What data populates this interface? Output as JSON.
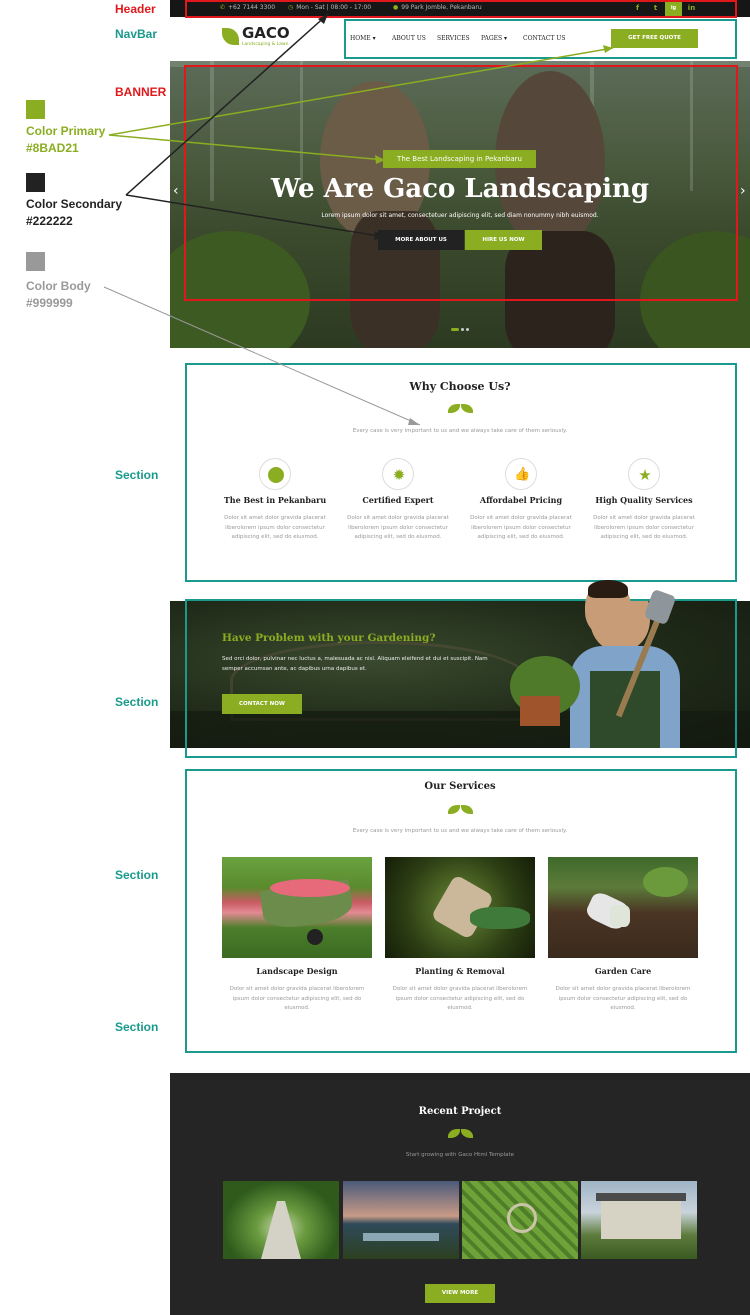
{
  "annotations": {
    "header": "Header",
    "navbar": "NavBar",
    "banner": "BANNER",
    "section_labels": [
      "Section",
      "Section",
      "Section",
      "Section"
    ],
    "colors": [
      {
        "name": "Color Primary",
        "hex": "#8BAD21",
        "swatch": "#8BAD21",
        "text_color": "#8BAD21"
      },
      {
        "name": "Color Secondary",
        "hex": "#222222",
        "swatch": "#222222",
        "text_color": "#222222"
      },
      {
        "name": "Color Body",
        "hex": "#999999",
        "swatch": "#999999",
        "text_color": "#999999"
      }
    ]
  },
  "topbar": {
    "phone": "+62 7144 3300",
    "hours": "Mon - Sat | 08:00 - 17:00",
    "address": "99 Park Jomble, Pekanbaru",
    "social": [
      "f",
      "t",
      "ig",
      "in"
    ]
  },
  "navbar": {
    "logo_title": "GACO",
    "logo_sub": "Landscaping & Lawn",
    "items": [
      "HOME",
      "ABOUT US",
      "SERVICES",
      "PAGES",
      "CONTACT US"
    ],
    "cta": "GET FREE QUOTE"
  },
  "banner": {
    "tag": "The Best Landscaping in Pekanbaru",
    "title": "We Are Gaco Landscaping",
    "desc": "Lorem ipsum dolor sit amet, consectetuer adipiscing elit, sed diam nonummy nibh euismod.",
    "btn_more": "MORE ABOUT US",
    "btn_hire": "HIRE US NOW",
    "prev": "‹",
    "next": "›"
  },
  "why": {
    "title": "Why Choose Us?",
    "sub": "Every case is very important to us and we always take care of them seriously.",
    "items": [
      {
        "title": "The Best in Pekanbaru",
        "icon": "globe-icon",
        "text": "Dolor sit amet dolor gravida placerat liberolorem ipsum dolor consectetur adipiscing elit, sed do eiusmod."
      },
      {
        "title": "Certified Expert",
        "icon": "badge-icon",
        "text": "Dolor sit amet dolor gravida placerat liberolorem ipsum dolor consectetur adipiscing elit, sed do eiusmod."
      },
      {
        "title": "Affordabel Pricing",
        "icon": "thumbs-up-icon",
        "text": "Dolor sit amet dolor gravida placerat liberolorem ipsum dolor consectetur adipiscing elit, sed do eiusmod."
      },
      {
        "title": "High Quality Services",
        "icon": "star-icon",
        "text": "Dolor sit amet dolor gravida placerat liberolorem ipsum dolor consectetur adipiscing elit, sed do eiusmod."
      }
    ]
  },
  "cta": {
    "title": "Have Problem with your Gardening?",
    "text": "Sed orci dolor, pulvinar nec luctus a, malesuada ac nisl. Aliquam eleifend et dui et suscipit. Nam semper accumsan ante, ac dapibus urna dapibus et.",
    "button": "CONTACT NOW"
  },
  "services": {
    "title": "Our Services",
    "sub": "Every case is very important to us and we always take care of them seriously.",
    "items": [
      {
        "title": "Landscape Design",
        "text": "Dolor sit amet dolor gravida placerat liberolorem ipsum dolor consectetur adipiscing elit, sed do eiusmod."
      },
      {
        "title": "Planting & Removal",
        "text": "Dolor sit amet dolor gravida placerat liberolorem ipsum dolor consectetur adipiscing elit, sed do eiusmod."
      },
      {
        "title": "Garden Care",
        "text": "Dolor sit amet dolor gravida placerat liberolorem ipsum dolor consectetur adipiscing elit, sed do eiusmod."
      }
    ]
  },
  "recent": {
    "title": "Recent Project",
    "sub": "Start growing with Gaco Html Template",
    "button": "VIEW MORE"
  }
}
